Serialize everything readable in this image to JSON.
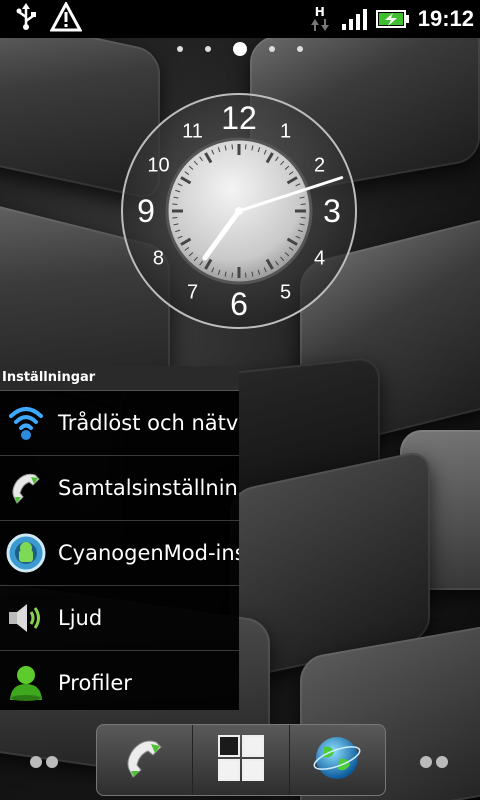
{
  "status_bar": {
    "time": "19:12",
    "network_type": "H",
    "icons": [
      "usb-icon",
      "warning-icon",
      "data-arrows-icon",
      "signal-icon",
      "battery-charging-icon"
    ]
  },
  "home": {
    "page_count": 5,
    "active_page": 3
  },
  "clock_widget": {
    "numerals": [
      "12",
      "1",
      "2",
      "3",
      "4",
      "5",
      "6",
      "7",
      "8",
      "9",
      "10",
      "11"
    ],
    "time": "19:12"
  },
  "settings_widget": {
    "title": "Inställningar",
    "items": [
      {
        "label": "Trådlöst och nätverk",
        "icon": "wifi-icon"
      },
      {
        "label": "Samtalsinställningar",
        "icon": "phone-icon"
      },
      {
        "label": "CyanogenMod-inställningar",
        "icon": "cyanogenmod-icon"
      },
      {
        "label": "Ljud",
        "icon": "speaker-icon"
      },
      {
        "label": "Profiler",
        "icon": "profile-icon"
      }
    ]
  },
  "dock": {
    "buttons": [
      {
        "name": "phone",
        "icon": "phone-icon"
      },
      {
        "name": "all-apps",
        "icon": "grid-icon"
      },
      {
        "name": "browser",
        "icon": "globe-icon"
      }
    ]
  }
}
